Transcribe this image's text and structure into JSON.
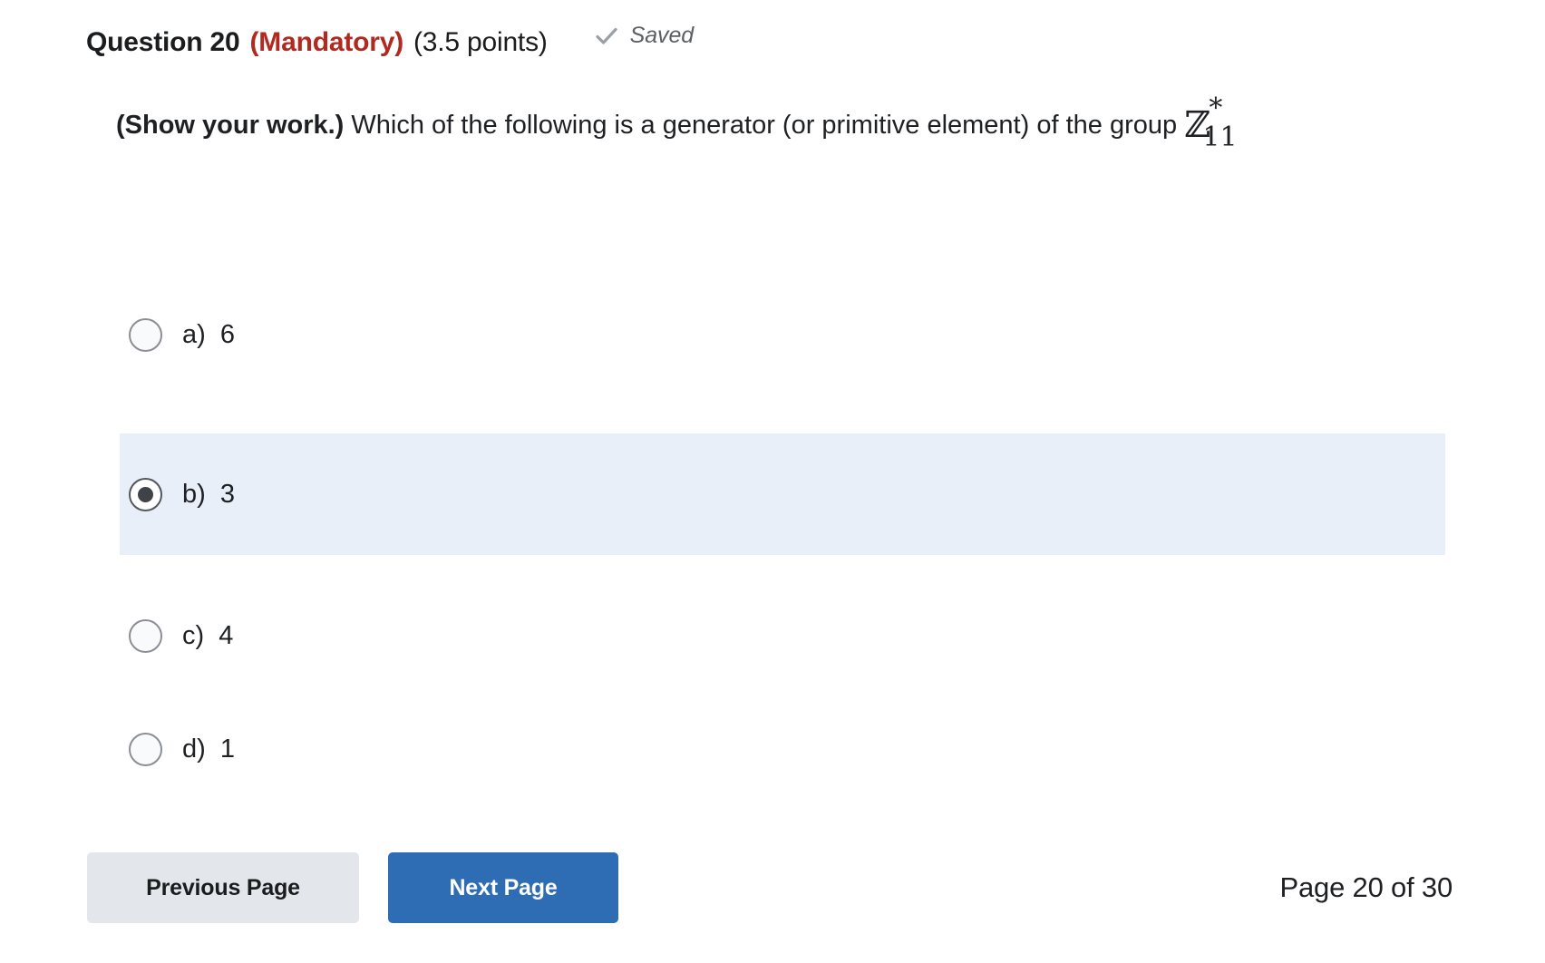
{
  "header": {
    "question_title": "Question 20",
    "mandatory_label": "(Mandatory)",
    "points_label": "(3.5 points)",
    "saved_label": "Saved",
    "check_icon": "check-icon",
    "mandatory_color": "#b02a22",
    "check_color": "#9aa0a6"
  },
  "question": {
    "prompt_bold": "(Show your work.)",
    "prompt_rest": " Which of the following is a generator (or primitive element) of the group ",
    "math": {
      "base": "ℤ",
      "superscript": "*",
      "subscript": "11"
    },
    "group_word": "group "
  },
  "options": [
    {
      "id": "a",
      "label": "a)  6",
      "selected": false
    },
    {
      "id": "b",
      "label": "b)  3",
      "selected": true
    },
    {
      "id": "c",
      "label": "c)  4",
      "selected": false
    },
    {
      "id": "d",
      "label": "d)  1",
      "selected": false
    }
  ],
  "footer": {
    "previous_label": "Previous Page",
    "next_label": "Next Page",
    "page_indicator": "Page 20 of 30",
    "next_button_color": "#2e6cb3",
    "previous_button_color": "#e3e6eb"
  },
  "theme": {
    "selected_row_background": "#e8eff9",
    "page_background": "#ffffff"
  }
}
